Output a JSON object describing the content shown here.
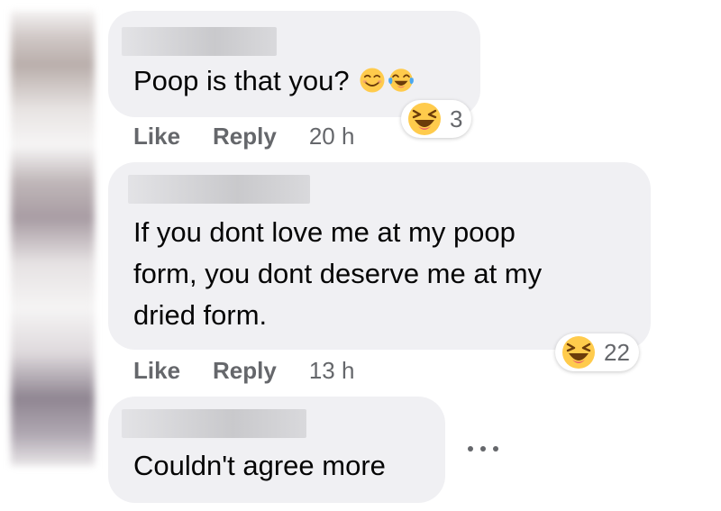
{
  "comments": [
    {
      "text": "Poop is that you?",
      "inline_emojis": [
        "smiling-face-icon",
        "tears-of-joy-icon"
      ],
      "actions": {
        "like": "Like",
        "reply": "Reply",
        "time": "20 h"
      },
      "reaction": {
        "icon": "laughing-face-icon",
        "count": "3"
      }
    },
    {
      "text": "If you dont love me at my poop\nform, you dont deserve me at my\ndried form.",
      "actions": {
        "like": "Like",
        "reply": "Reply",
        "time": "13 h"
      },
      "reaction": {
        "icon": "laughing-face-icon",
        "count": "22"
      }
    },
    {
      "text": "Couldn't agree more"
    }
  ],
  "colors": {
    "bubble": "#f0f0f3",
    "secondary_text": "#65676b",
    "primary_text": "#050505",
    "emoji_yellow": "#ffcb4c"
  }
}
